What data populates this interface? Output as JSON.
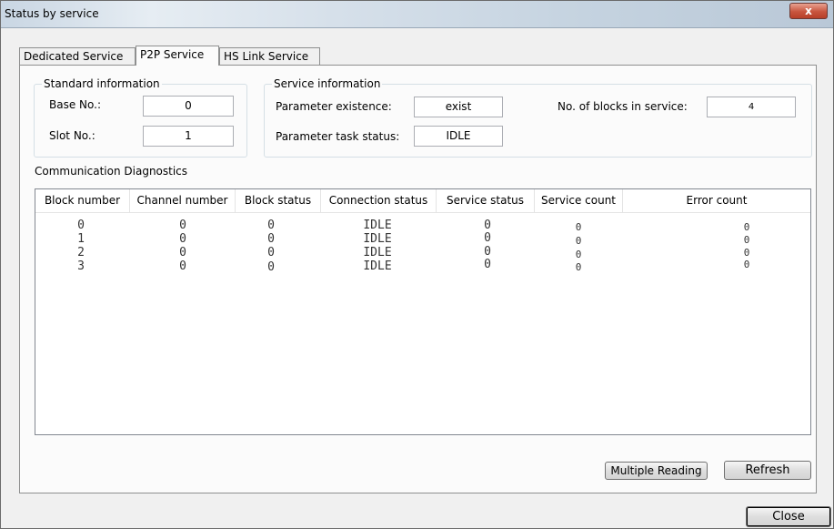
{
  "window": {
    "title": "Status by service",
    "close_glyph": "x"
  },
  "tabs": [
    {
      "label": "Dedicated Service",
      "active": false
    },
    {
      "label": "P2P Service",
      "active": true
    },
    {
      "label": "HS Link Service",
      "active": false
    }
  ],
  "standard_info": {
    "legend": "Standard information",
    "base_label": "Base No.:",
    "base_value": "0",
    "slot_label": "Slot No.:",
    "slot_value": "1"
  },
  "service_info": {
    "legend": "Service information",
    "param_existence_label": "Parameter existence:",
    "param_existence_value": "exist",
    "param_task_label": "Parameter task status:",
    "param_task_value": "IDLE",
    "blocks_label": "No. of blocks in service:",
    "blocks_value": "4"
  },
  "diagnostics": {
    "title": "Communication Diagnostics",
    "columns": [
      "Block number",
      "Channel number",
      "Block status",
      "Connection status",
      "Service status",
      "Service count",
      "Error count"
    ],
    "rows": [
      [
        "0",
        "0",
        "0",
        "IDLE",
        "0",
        "0",
        "0"
      ],
      [
        "1",
        "0",
        "0",
        "IDLE",
        "0",
        "0",
        "0"
      ],
      [
        "2",
        "0",
        "0",
        "IDLE",
        "0",
        "0",
        "0"
      ],
      [
        "3",
        "0",
        "0",
        "IDLE",
        "0",
        "0",
        "0"
      ]
    ]
  },
  "buttons": {
    "multiple_reading": "Multiple Reading",
    "refresh": "Refresh",
    "close": "Close"
  }
}
